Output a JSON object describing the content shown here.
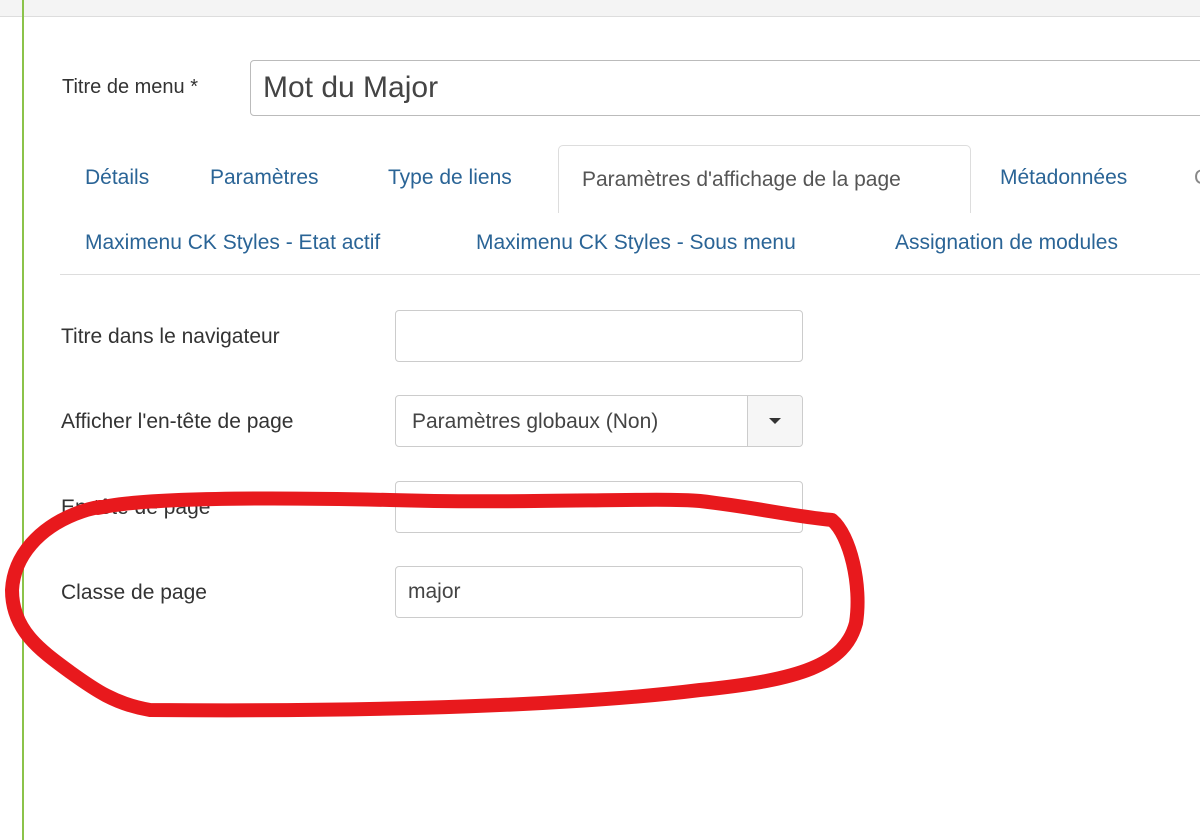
{
  "header": {
    "title_label": "Titre de menu *",
    "title_value": "Mot du Major"
  },
  "tabs": {
    "row1": [
      "Détails",
      "Paramètres",
      "Type de liens",
      "Paramètres d'affichage de la page",
      "Métadonnées"
    ],
    "row1_clipped": "C",
    "row2": [
      "Maximenu CK Styles - Etat actif",
      "Maximenu CK Styles - Sous menu",
      "Assignation de modules"
    ],
    "active": "Paramètres d'affichage de la page"
  },
  "fields": {
    "browser_title_label": "Titre dans le navigateur",
    "browser_title_value": "",
    "show_heading_label": "Afficher l'en-tête de page",
    "show_heading_value": "Paramètres globaux (Non)",
    "page_heading_label": "En-tête de page",
    "page_heading_value": "",
    "page_class_label": "Classe de page",
    "page_class_value": "major"
  },
  "colors": {
    "annotation": "#e8191d",
    "link": "#2a6496",
    "left_border": "#8bc34a"
  }
}
